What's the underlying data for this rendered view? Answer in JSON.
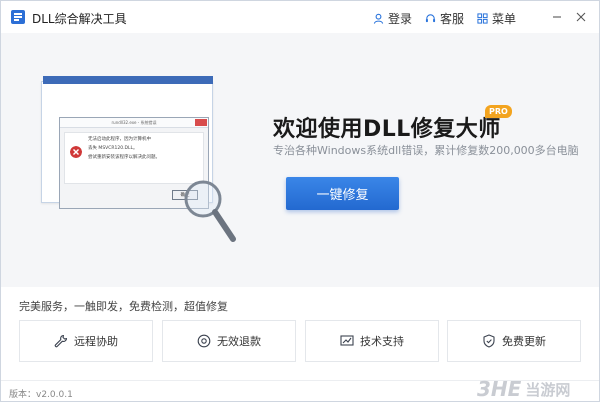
{
  "window": {
    "title": "DLL综合解决工具",
    "login_label": "登录",
    "service_label": "客服",
    "menu_label": "菜单"
  },
  "hero": {
    "title": "欢迎使用DLL修复大师",
    "badge": "PRO",
    "subtitle": "专治各种Windows系统dll错误，累计修复数200,000多台电脑",
    "repair_button": "一键修复",
    "dialog": {
      "title": "rundll32.exe - 系统错误",
      "lines": [
        "无法启动此程序，因为计算机中",
        "丢失 MSVCR120.DLL。",
        "尝试重新安装该程序以解决此问题。"
      ],
      "ok_label": "确定"
    }
  },
  "features": {
    "label": "完美服务，一触即发，免费检测，超值修复",
    "cards": [
      {
        "label": "远程协助",
        "icon": "wrench-icon"
      },
      {
        "label": "无效退款",
        "icon": "refund-icon"
      },
      {
        "label": "技术支持",
        "icon": "chart-monitor-icon"
      },
      {
        "label": "免费更新",
        "icon": "shield-icon"
      }
    ]
  },
  "footer": {
    "version": "版本：v2.0.0.1",
    "watermark_mark": "3HE",
    "watermark_text": "当游网"
  },
  "colors": {
    "accent": "#2a74dc",
    "badge": "#f3a41f",
    "hero_bg": "#f5f6f8"
  }
}
